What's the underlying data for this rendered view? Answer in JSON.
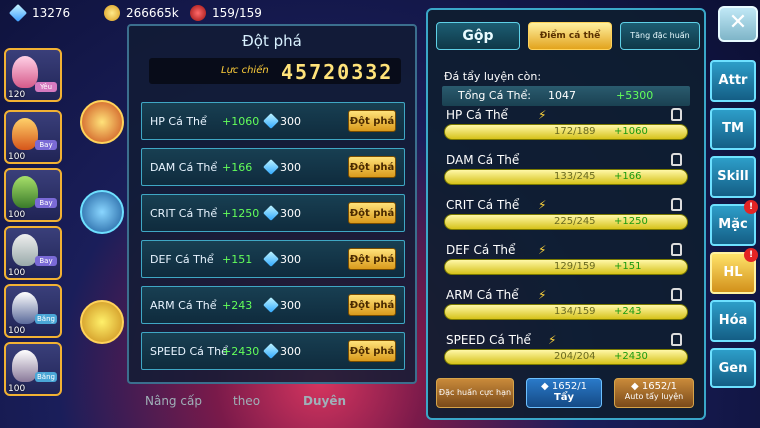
{
  "resources": {
    "gems": "13276",
    "gold": "266665k",
    "stamina": "159/159"
  },
  "breakthrough": {
    "title": "Đột phá",
    "power_label": "Lực chiến",
    "power_value": "45720332",
    "rows": [
      {
        "name": "HP Cá Thể",
        "bonus": "+1060",
        "cost": "300",
        "button": "Đột phá"
      },
      {
        "name": "DAM Cá Thể",
        "bonus": "+166",
        "cost": "300",
        "button": "Đột phá"
      },
      {
        "name": "CRIT Cá Thể",
        "bonus": "+1250",
        "cost": "300",
        "button": "Đột phá"
      },
      {
        "name": "DEF Cá Thể",
        "bonus": "+151",
        "cost": "300",
        "button": "Đột phá"
      },
      {
        "name": "ARM Cá Thể",
        "bonus": "+243",
        "cost": "300",
        "button": "Đột phá"
      },
      {
        "name": "SPEED Cá Thể",
        "bonus": "+2430",
        "cost": "300",
        "button": "Đột phá"
      }
    ],
    "bottom_tabs": [
      "Nâng cấp",
      "theo",
      "Duyên"
    ]
  },
  "training": {
    "tabs": [
      "Gộp",
      "Điểm cá thể",
      "Tăng đặc huấn"
    ],
    "remaining_label": "Đá tẩy luyện còn:",
    "total_label": "Tổng Cá Thể:",
    "total_value": "1047",
    "total_delta": "+5300",
    "stats": [
      {
        "name": "HP Cá Thể",
        "value": "172/189",
        "delta": "+1060"
      },
      {
        "name": "DAM Cá Thể",
        "value": "133/245",
        "delta": "+166"
      },
      {
        "name": "CRIT Cá Thể",
        "value": "225/245",
        "delta": "+1250"
      },
      {
        "name": "DEF Cá Thể",
        "value": "129/159",
        "delta": "+151"
      },
      {
        "name": "ARM Cá Thể",
        "value": "134/159",
        "delta": "+243"
      },
      {
        "name": "SPEED Cá Thể",
        "value": "204/204",
        "delta": "+2430"
      }
    ],
    "buttons": {
      "special": "Đặc huấn cực hạn",
      "wash_count": "1652/1",
      "wash": "Tẩy",
      "auto_count": "1652/1",
      "auto": "Auto tẩy luyện"
    }
  },
  "side_menu": [
    "Attr",
    "TM",
    "Skill",
    "Mặc",
    "HL",
    "Hóa",
    "Gen"
  ],
  "roster": [
    {
      "level": "120",
      "tag": "Yêu"
    },
    {
      "level": "100",
      "tag": "Bay"
    },
    {
      "level": "100",
      "tag": "Bay"
    },
    {
      "level": "100",
      "tag": "Bay"
    },
    {
      "level": "100",
      "tag": "Băng"
    },
    {
      "level": "100",
      "tag": "Băng"
    }
  ]
}
